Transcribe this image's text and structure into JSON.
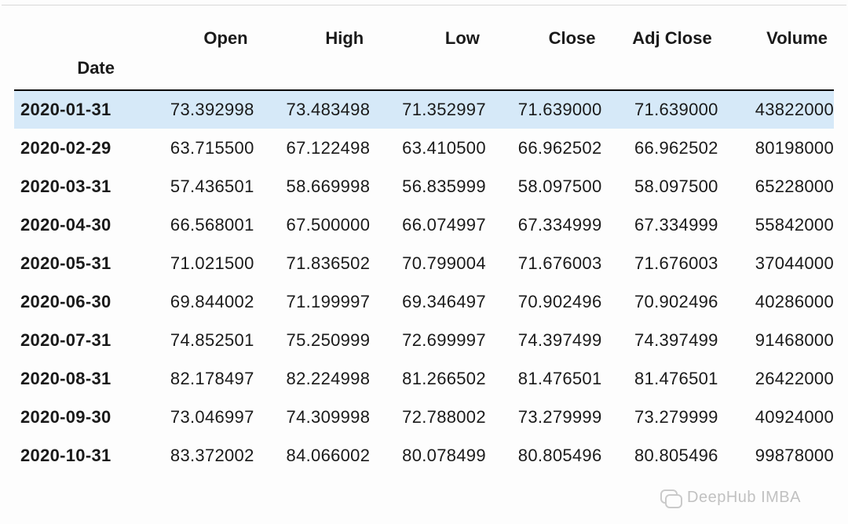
{
  "index_label": "Date",
  "columns": [
    "Open",
    "High",
    "Low",
    "Close",
    "Adj Close",
    "Volume"
  ],
  "selected_row": 0,
  "rows": [
    {
      "date": "2020-01-31",
      "open": "73.392998",
      "high": "73.483498",
      "low": "71.352997",
      "close": "71.639000",
      "adj": "71.639000",
      "vol": "43822000"
    },
    {
      "date": "2020-02-29",
      "open": "63.715500",
      "high": "67.122498",
      "low": "63.410500",
      "close": "66.962502",
      "adj": "66.962502",
      "vol": "80198000"
    },
    {
      "date": "2020-03-31",
      "open": "57.436501",
      "high": "58.669998",
      "low": "56.835999",
      "close": "58.097500",
      "adj": "58.097500",
      "vol": "65228000"
    },
    {
      "date": "2020-04-30",
      "open": "66.568001",
      "high": "67.500000",
      "low": "66.074997",
      "close": "67.334999",
      "adj": "67.334999",
      "vol": "55842000"
    },
    {
      "date": "2020-05-31",
      "open": "71.021500",
      "high": "71.836502",
      "low": "70.799004",
      "close": "71.676003",
      "adj": "71.676003",
      "vol": "37044000"
    },
    {
      "date": "2020-06-30",
      "open": "69.844002",
      "high": "71.199997",
      "low": "69.346497",
      "close": "70.902496",
      "adj": "70.902496",
      "vol": "40286000"
    },
    {
      "date": "2020-07-31",
      "open": "74.852501",
      "high": "75.250999",
      "low": "72.699997",
      "close": "74.397499",
      "adj": "74.397499",
      "vol": "91468000"
    },
    {
      "date": "2020-08-31",
      "open": "82.178497",
      "high": "82.224998",
      "low": "81.266502",
      "close": "81.476501",
      "adj": "81.476501",
      "vol": "26422000"
    },
    {
      "date": "2020-09-30",
      "open": "73.046997",
      "high": "74.309998",
      "low": "72.788002",
      "close": "73.279999",
      "adj": "73.279999",
      "vol": "40924000"
    },
    {
      "date": "2020-10-31",
      "open": "83.372002",
      "high": "84.066002",
      "low": "80.078499",
      "close": "80.805496",
      "adj": "80.805496",
      "vol": "99878000"
    }
  ],
  "watermark": "DeepHub IMBA",
  "chart_data": {
    "type": "table",
    "index": "Date",
    "columns": [
      "Open",
      "High",
      "Low",
      "Close",
      "Adj Close",
      "Volume"
    ],
    "data": [
      [
        "2020-01-31",
        73.392998,
        73.483498,
        71.352997,
        71.639,
        71.639,
        43822000
      ],
      [
        "2020-02-29",
        63.7155,
        67.122498,
        63.4105,
        66.962502,
        66.962502,
        80198000
      ],
      [
        "2020-03-31",
        57.436501,
        58.669998,
        56.835999,
        58.0975,
        58.0975,
        65228000
      ],
      [
        "2020-04-30",
        66.568001,
        67.5,
        66.074997,
        67.334999,
        67.334999,
        55842000
      ],
      [
        "2020-05-31",
        71.0215,
        71.836502,
        70.799004,
        71.676003,
        71.676003,
        37044000
      ],
      [
        "2020-06-30",
        69.844002,
        71.199997,
        69.346497,
        70.902496,
        70.902496,
        40286000
      ],
      [
        "2020-07-31",
        74.852501,
        75.250999,
        72.699997,
        74.397499,
        74.397499,
        91468000
      ],
      [
        "2020-08-31",
        82.178497,
        82.224998,
        81.266502,
        81.476501,
        81.476501,
        26422000
      ],
      [
        "2020-09-30",
        73.046997,
        74.309998,
        72.788002,
        73.279999,
        73.279999,
        40924000
      ],
      [
        "2020-10-31",
        83.372002,
        84.066002,
        80.078499,
        80.805496,
        80.805496,
        99878000
      ]
    ]
  }
}
